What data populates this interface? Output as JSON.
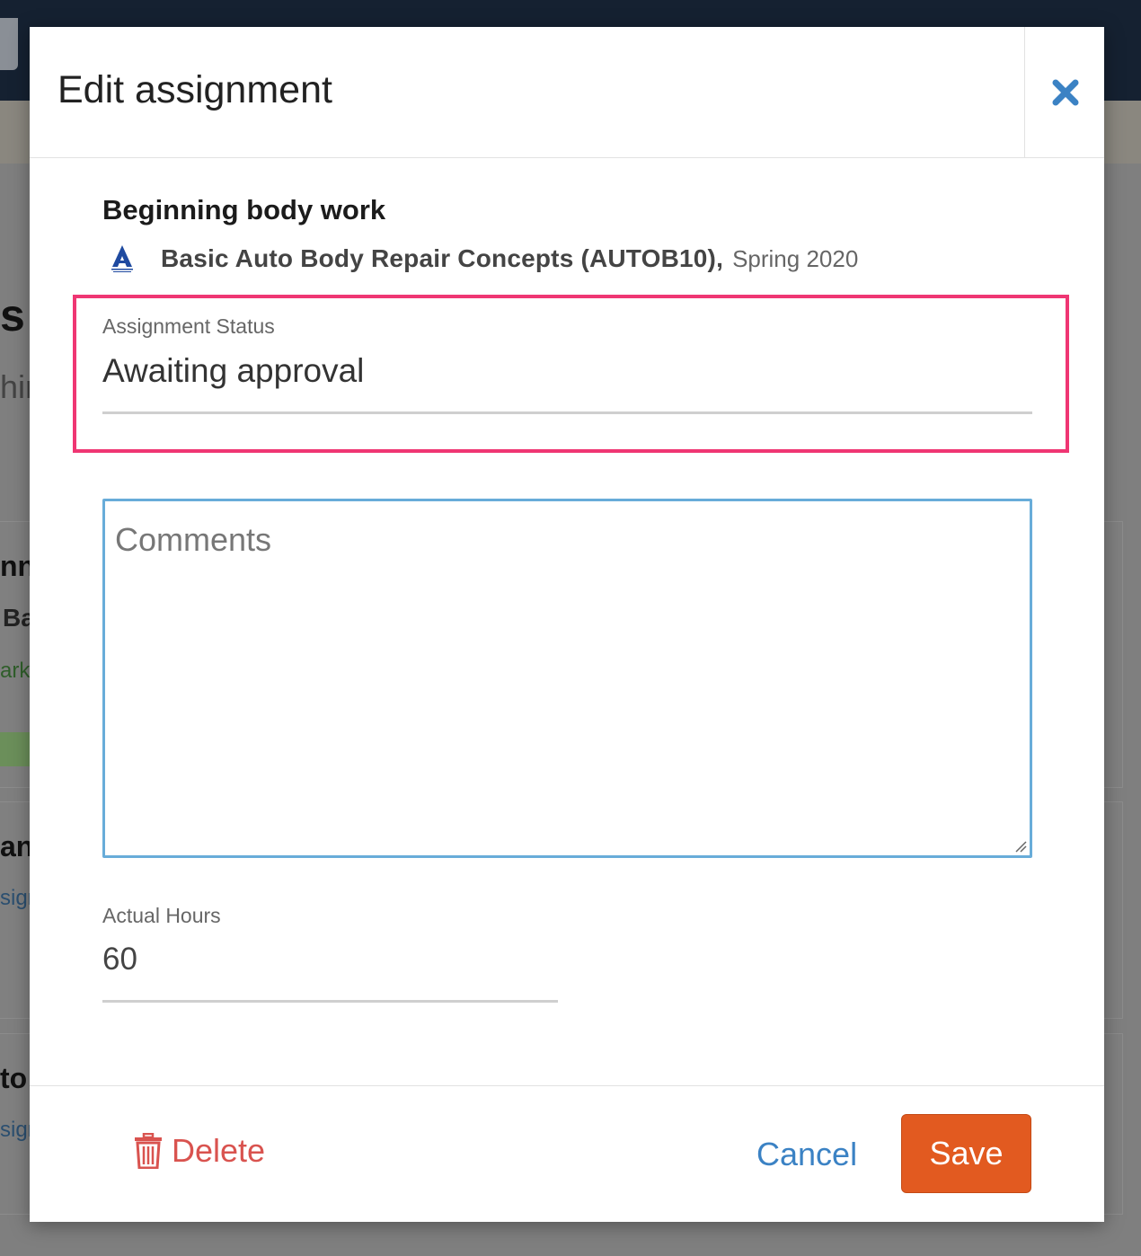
{
  "modal": {
    "title": "Edit assignment",
    "close_icon": "close-icon"
  },
  "assignment": {
    "title": "Beginning body work",
    "course_name": "Basic Auto Body Repair Concepts (AUTOB10),",
    "course_term": "Spring 2020",
    "course_logo_icon": "college-logo-icon"
  },
  "status_field": {
    "label": "Assignment Status",
    "value": "Awaiting approval"
  },
  "comments_field": {
    "placeholder": "Comments",
    "value": ""
  },
  "hours_field": {
    "label": "Actual Hours",
    "value": "60"
  },
  "footer": {
    "delete_label": "Delete",
    "delete_icon": "trash-icon",
    "cancel_label": "Cancel",
    "save_label": "Save"
  },
  "background": {
    "fragments": [
      "s",
      "hir",
      "nn",
      "Ba",
      "ark",
      "anc",
      "sign",
      "to",
      "sign"
    ]
  },
  "colors": {
    "highlight": "#ef3673",
    "primary_link": "#3b82c4",
    "save": "#e25a20",
    "danger": "#d9534f",
    "focus_border": "#68acd9"
  }
}
